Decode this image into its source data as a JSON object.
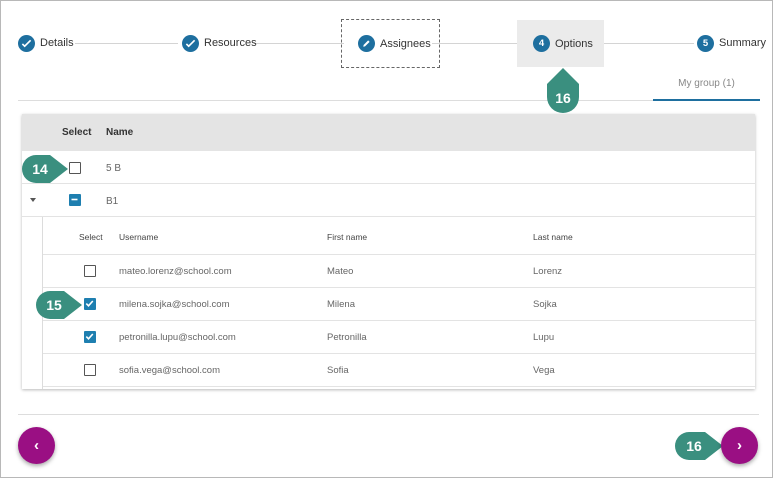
{
  "stepper": {
    "steps": [
      {
        "label": "Details",
        "marker": "check-icon"
      },
      {
        "label": "Resources",
        "marker": "check-icon"
      },
      {
        "label": "Assignees",
        "marker": "pencil-icon"
      },
      {
        "label": "Options",
        "number": "4"
      },
      {
        "label": "Summary",
        "number": "5"
      }
    ]
  },
  "tabs": [
    {
      "label": "My group (1)"
    }
  ],
  "table": {
    "headers": {
      "select": "Select",
      "name": "Name"
    },
    "groups": [
      {
        "name": "5 B",
        "checkbox": "unchecked"
      },
      {
        "name": "B1",
        "checkbox": "indeterminate",
        "expanded": true
      }
    ],
    "subtable": {
      "headers": {
        "select": "Select",
        "username": "Username",
        "first_name": "First name",
        "last_name": "Last name"
      },
      "rows": [
        {
          "username": "mateo.lorenz@school.com",
          "first_name": "Mateo",
          "last_name": "Lorenz",
          "checked": false
        },
        {
          "username": "milena.sojka@school.com",
          "first_name": "Milena",
          "last_name": "Sojka",
          "checked": true
        },
        {
          "username": "petronilla.lupu@school.com",
          "first_name": "Petronilla",
          "last_name": "Lupu",
          "checked": true
        },
        {
          "username": "sofia.vega@school.com",
          "first_name": "Sofia",
          "last_name": "Vega",
          "checked": false
        }
      ]
    }
  },
  "callouts": {
    "c14": "14",
    "c15": "15",
    "c16_top": "16",
    "c16_bottom": "16"
  },
  "nav": {
    "prev": "‹",
    "next": "›"
  },
  "colors": {
    "accent": "#1e6f9f",
    "callout": "#3a8f7f",
    "nav_button": "#9a0f83"
  }
}
